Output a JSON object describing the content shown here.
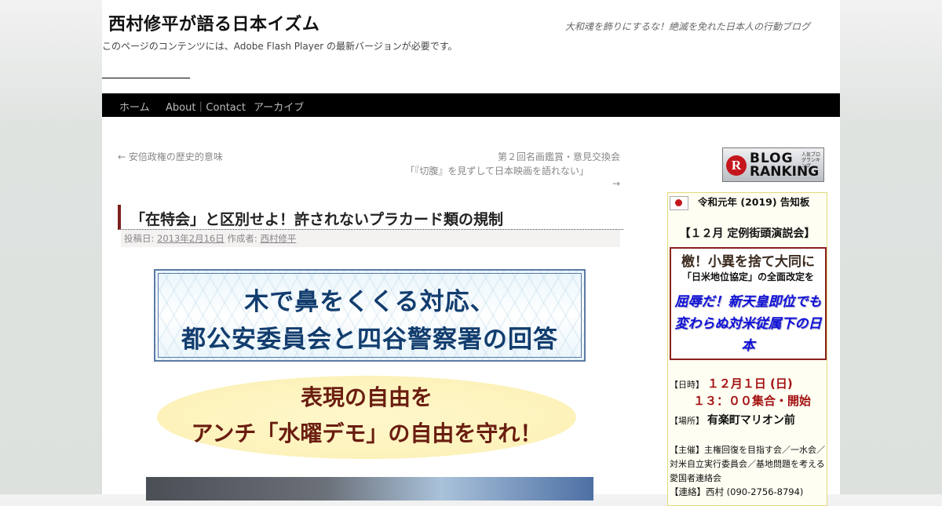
{
  "header": {
    "site_title": "西村修平が語る日本イズム",
    "site_description": "大和魂を飾りにするな！絶滅を免れた日本人の行動ブログ",
    "flash_notice": "このページのコンテンツには、Adobe Flash Player の最新バージョンが必要です。"
  },
  "nav": {
    "items": [
      "ホーム",
      "About｜Contact",
      "アーカイブ"
    ]
  },
  "post_nav": {
    "prev": "← 安倍政権の歴史的意味",
    "next_line1": "第２回名画鑑賞・意見交換会",
    "next_line2": "「『切腹』を見ずして日本映画を語れない」",
    "next_arrow": "→"
  },
  "post": {
    "title": "「在特会」と区別せよ！許されないプラカード類の規制",
    "meta_posted": "投稿日:",
    "meta_date": "2013年2月16日",
    "meta_author_label": "作成者:",
    "meta_author": "西村修平"
  },
  "banner1": {
    "line1": "木で鼻をくくる対応、",
    "line2": "都公安委員会と四谷警察署の回答"
  },
  "banner2": {
    "line1": "表現の自由を",
    "line2": "アンチ「水曜デモ」の自由を守れ！"
  },
  "sidebar": {
    "ranking": {
      "letter": "R",
      "word1": "BLOG",
      "word2": "RANKING",
      "small": "人気ブログランキング"
    },
    "notice": {
      "title": "令和元年 (2019) 告知板",
      "subtitle": "【１２月 定例街頭演説会】",
      "rb_line1": "檄！小異を捨て大同に",
      "rb_line2": "「日米地位協定」の全面改定を",
      "rb_line3": "屈辱だ！新天皇即位でも変わらぬ対米従属下の日本",
      "date_label": "【日時】",
      "date_value": "１２月１日 (日)",
      "time_value": "１３：００集合・開始",
      "place_label": "【場所】",
      "place_value": "有楽町マリオン前",
      "organizers": "【主催】主権回復を目指す会／一水会／対米自立実行委員会／基地問題を考える愛国者連絡会",
      "contact": "【連絡】西村 (090-2756-8794)"
    }
  },
  "colors": {
    "nav_bg": "#000000",
    "title_accent": "#7d1f1f",
    "banner_blue": "#123d6e",
    "banner_brown": "#6a1d10",
    "notice_red": "#a31212",
    "notice_blue": "#1010d8"
  }
}
